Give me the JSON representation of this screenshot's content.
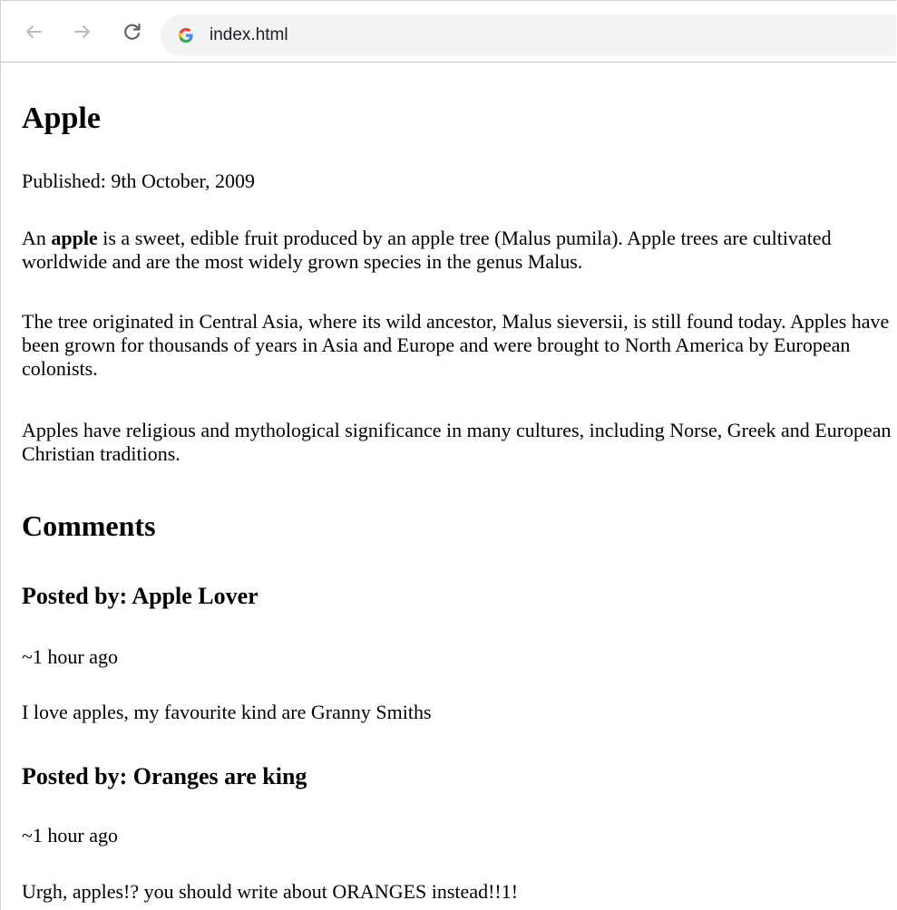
{
  "browser": {
    "url": "index.html"
  },
  "article": {
    "title": "Apple",
    "published": "Published: 9th October, 2009",
    "p1_prefix": "An ",
    "p1_bold": "apple",
    "p1_suffix": " is a sweet, edible fruit produced by an apple tree (Malus pumila). Apple trees are cultivated worldwide and are the most widely grown species in the genus Malus.",
    "p2": "The tree originated in Central Asia, where its wild ancestor, Malus sieversii, is still found today. Apples have been grown for thousands of years in Asia and Europe and were brought to North America by European colonists.",
    "p3": "Apples have religious and mythological significance in many cultures, including Norse, Greek and European Christian traditions."
  },
  "comments": {
    "heading": "Comments",
    "items": [
      {
        "author": "Posted by: Apple Lover",
        "time": "~1 hour ago",
        "body": "I love apples, my favourite kind are Granny Smiths"
      },
      {
        "author": "Posted by: Oranges are king",
        "time": "~1 hour ago",
        "body": "Urgh, apples!? you should write about ORANGES instead!!1!"
      }
    ]
  }
}
